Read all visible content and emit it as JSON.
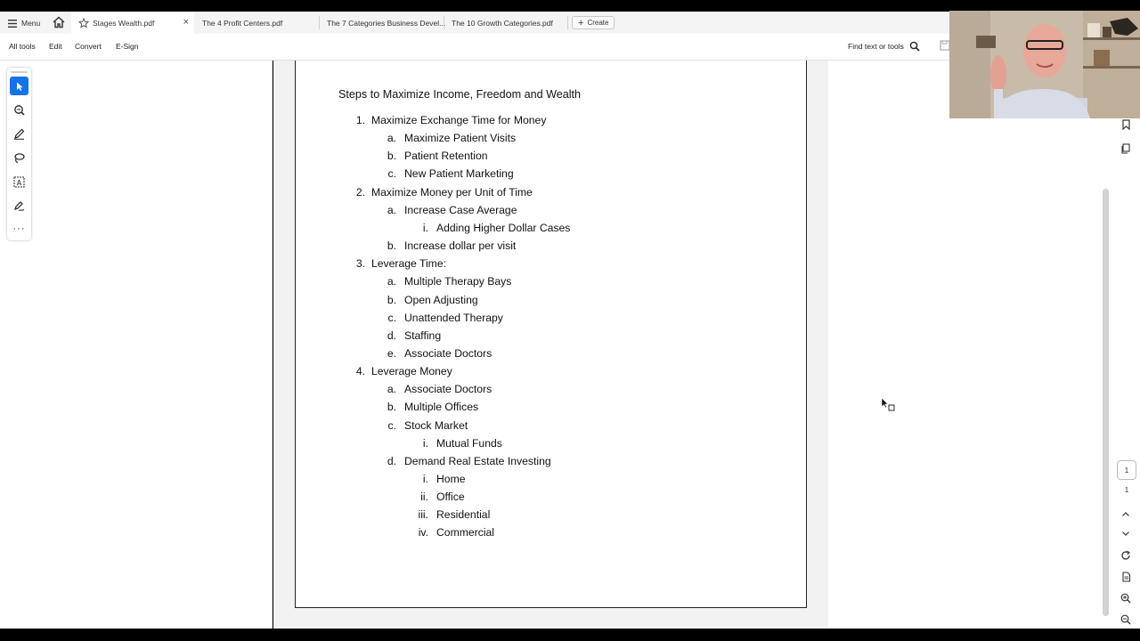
{
  "tabbar": {
    "menu_label": "Menu",
    "tabs": [
      {
        "label": "Stages Wealth.pdf",
        "active": true
      },
      {
        "label": "The 4 Profit Centers.pdf",
        "active": false
      },
      {
        "label": "The 7 Categories Business Devel...",
        "active": false
      },
      {
        "label": "The 10 Growth Categories.pdf",
        "active": false
      }
    ],
    "create_label": "Create"
  },
  "toolbar": {
    "all_tools": "All tools",
    "edit": "Edit",
    "convert": "Convert",
    "esign": "E-Sign",
    "find_label": "Find text or tools"
  },
  "left_rail": {
    "tools": [
      "select-tool-icon",
      "zoom-comment-icon",
      "pen-icon",
      "lasso-icon",
      "text-recognize-icon",
      "sign-icon",
      "more-icon"
    ]
  },
  "document": {
    "title": "Steps to Maximize Income, Freedom and Wealth",
    "items": [
      {
        "marker": "1.",
        "text": "Maximize Exchange Time for Money",
        "level": 1
      },
      {
        "marker": "a.",
        "text": "Maximize Patient Visits",
        "level": 2
      },
      {
        "marker": "b.",
        "text": "Patient Retention",
        "level": 2
      },
      {
        "marker": "c.",
        "text": "New Patient Marketing",
        "level": 2
      },
      {
        "marker": "2.",
        "text": "Maximize Money per Unit of Time",
        "level": 1
      },
      {
        "marker": "a.",
        "text": "Increase Case Average",
        "level": 2
      },
      {
        "marker": "i.",
        "text": "Adding Higher Dollar Cases",
        "level": 3
      },
      {
        "marker": "b.",
        "text": "Increase dollar per visit",
        "level": 2
      },
      {
        "marker": "3.",
        "text": "Leverage Time:",
        "level": 1
      },
      {
        "marker": "a.",
        "text": "Multiple Therapy Bays",
        "level": 2
      },
      {
        "marker": "b.",
        "text": "Open Adjusting",
        "level": 2
      },
      {
        "marker": "c.",
        "text": "Unattended Therapy",
        "level": 2
      },
      {
        "marker": "d.",
        "text": "Staffing",
        "level": 2
      },
      {
        "marker": "e.",
        "text": "Associate Doctors",
        "level": 2
      },
      {
        "marker": "4.",
        "text": "Leverage Money",
        "level": 1
      },
      {
        "marker": "a.",
        "text": "Associate Doctors",
        "level": 2
      },
      {
        "marker": "b.",
        "text": "Multiple Offices",
        "level": 2
      },
      {
        "marker": "c.",
        "text": "Stock Market",
        "level": 2
      },
      {
        "marker": "i.",
        "text": "Mutual Funds",
        "level": 3
      },
      {
        "marker": "d.",
        "text": "Demand Real Estate Investing",
        "level": 2
      },
      {
        "marker": "i.",
        "text": "Home",
        "level": 3
      },
      {
        "marker": "ii.",
        "text": "Office",
        "level": 3
      },
      {
        "marker": "iii.",
        "text": "Residential",
        "level": 3
      },
      {
        "marker": "iv.",
        "text": "Commercial",
        "level": 3
      }
    ]
  },
  "pager": {
    "current_page": "1",
    "total_pages": "1"
  },
  "colors": {
    "accent": "#1473e6",
    "tabbar_bg": "#f4f4f4",
    "doc_bg": "#f2f2f2"
  }
}
